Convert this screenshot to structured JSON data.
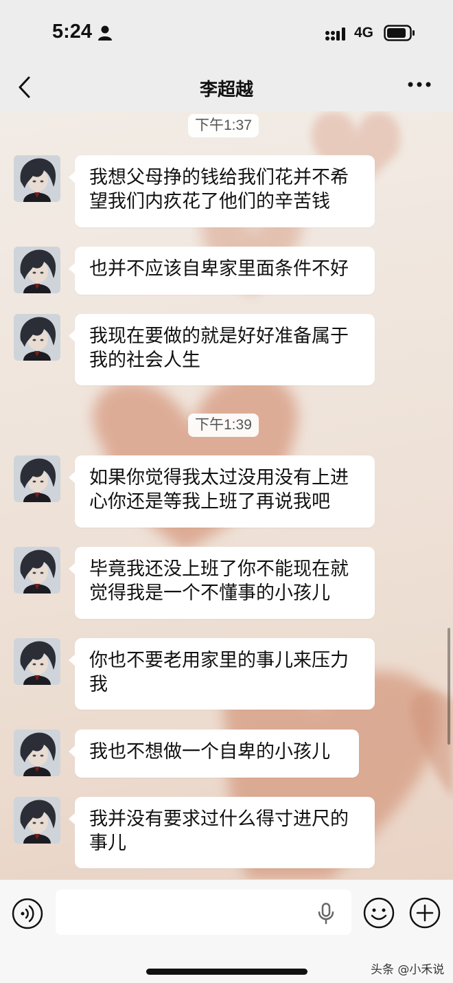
{
  "status_bar": {
    "time": "5:24",
    "network": "4G"
  },
  "header": {
    "title": "李超越"
  },
  "timestamps": [
    "下午1:37",
    "下午1:39"
  ],
  "messages": [
    {
      "text": "我想父母挣的钱给我们花并不希\n望我们内疚花了他们的辛苦钱"
    },
    {
      "text": "也并不应该自卑家里面条件不好"
    },
    {
      "text": "我现在要做的就是好好准备属于\n我的社会人生"
    },
    {
      "text": "如果你觉得我太过没用没有上进\n心你还是等我上班了再说我吧"
    },
    {
      "text": "毕竟我还没上班了你不能现在就\n觉得我是一个不懂事的小孩儿"
    },
    {
      "text": "你也不要老用家里的事儿来压力\n我"
    },
    {
      "text": "我也不想做一个自卑的小孩儿"
    },
    {
      "text": "我并没有要求过什么得寸进尺的\n事儿"
    }
  ],
  "input": {
    "value": ""
  },
  "watermark": "头条 @小禾说",
  "icons": {
    "back": "chevron-left-icon",
    "more": "more-dots-icon",
    "voice": "voice-icon",
    "mic": "mic-icon",
    "emoji": "emoji-icon",
    "plus": "plus-icon"
  },
  "colors": {
    "bar_background": "#ededed",
    "bubble": "#ffffff",
    "wallpaper_heart": "#d9a48c"
  }
}
